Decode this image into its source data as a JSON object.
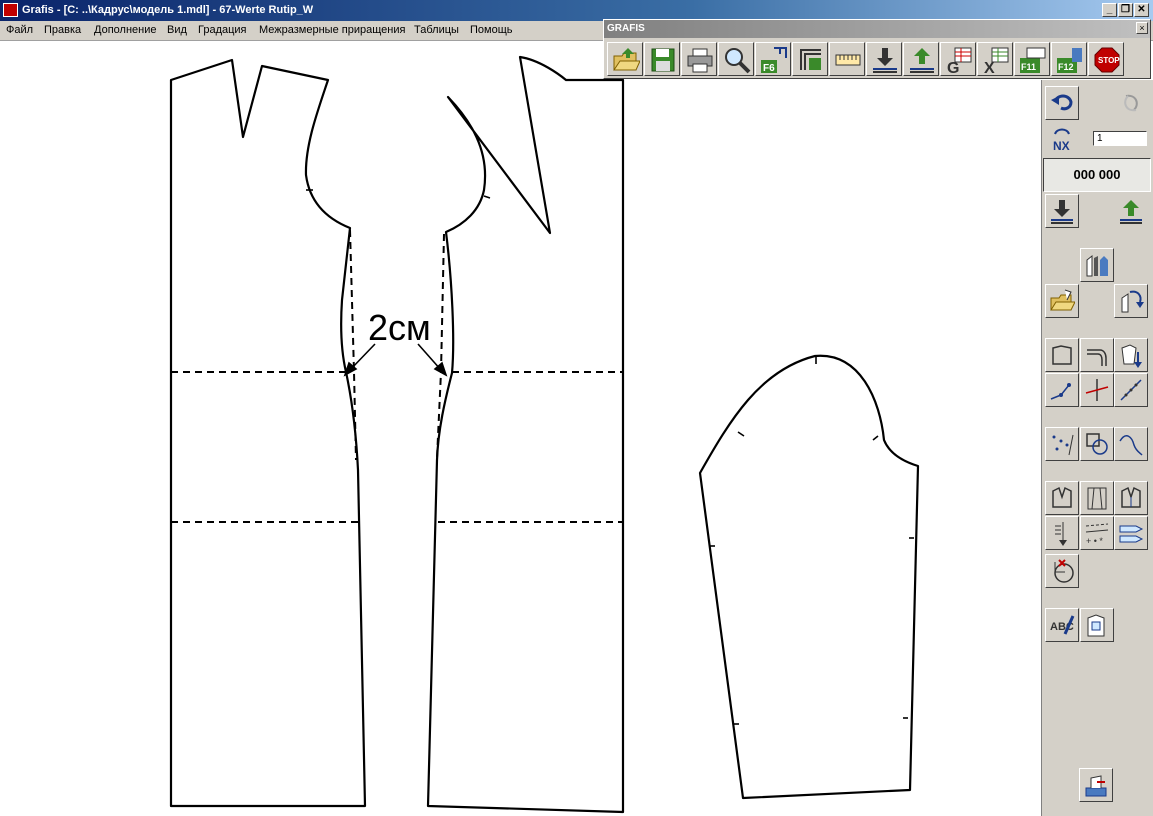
{
  "window": {
    "title": "Grafis - [C: ..\\Кадрус\\модель 1.mdl] - 67-Werte Rutip_W"
  },
  "menu": [
    "Файл",
    "Правка",
    "Дополнение",
    "Вид",
    "Градация",
    "Межразмерные приращения",
    "Таблицы",
    "Помощь"
  ],
  "palette": {
    "title": "GRAFIS",
    "close_label": "×",
    "buttons": [
      "open-folder-icon",
      "save-icon",
      "print-icon",
      "zoom-icon",
      "f6-icon",
      "grade-icon",
      "layers-icon",
      "measure-icon",
      "download-icon",
      "upload-icon",
      "g-icon",
      "x-icon",
      "f11-icon",
      "f12-icon",
      "stop-icon"
    ]
  },
  "sidebar": {
    "nx_value": "1",
    "counter": "000 000"
  },
  "canvas": {
    "annotation": "2см"
  },
  "colors": {
    "titlebar": "#0a246a",
    "panel": "#d4d0c8",
    "accent_green": "#3a8a2a",
    "stop_red": "#c00000"
  }
}
